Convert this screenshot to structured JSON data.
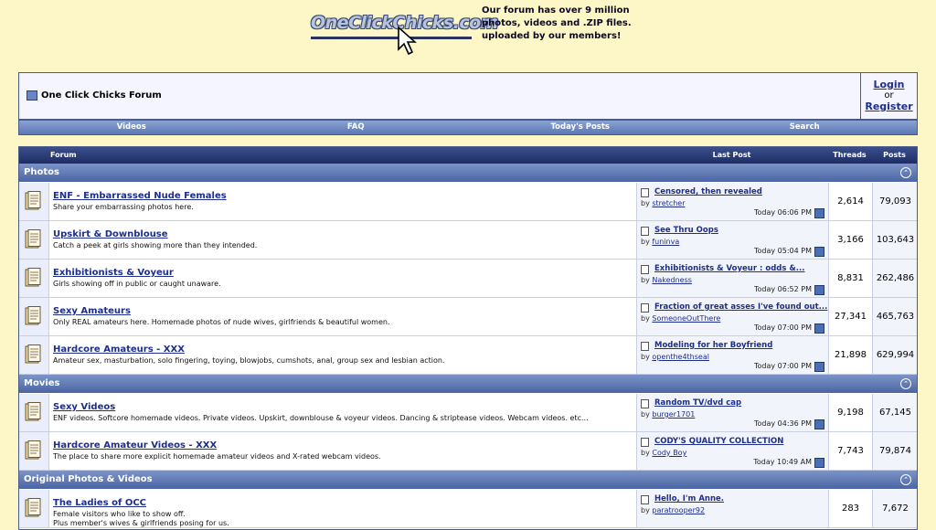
{
  "header": {
    "logo_text": "OneClickChicks.com",
    "tagline": "Our forum has over 9 million photos, videos and .ZIP files. uploaded by our members!"
  },
  "topbox": {
    "forum_name": "One Click Chicks Forum",
    "login": "Login",
    "or": "or",
    "register": "Register"
  },
  "nav": [
    "Videos",
    "FAQ",
    "Today's Posts",
    "Search"
  ],
  "table_headers": {
    "forum": "Forum",
    "last_post": "Last Post",
    "threads": "Threads",
    "posts": "Posts"
  },
  "categories": [
    {
      "name": "Photos",
      "forums": [
        {
          "title": "ENF - Embarrassed Nude Females",
          "desc": "Share your embarrassing photos here.",
          "last_title": "Censored, then revealed",
          "by": "by",
          "last_user": "stretcher",
          "when": "Today 06:06 PM",
          "threads": "2,614",
          "posts": "79,093"
        },
        {
          "title": "Upskirt & Downblouse",
          "desc": "Catch a peek at girls showing more than they intended.",
          "last_title": "See Thru Oops",
          "by": "by",
          "last_user": "funinva",
          "when": "Today 05:04 PM",
          "threads": "3,166",
          "posts": "103,643"
        },
        {
          "title": "Exhibitionists & Voyeur",
          "desc": "Girls showing off in public or caught unaware.",
          "last_title": "Exhibitionists & Voyeur : odds &...",
          "by": "by",
          "last_user": "Nakedness",
          "when": "Today 06:52 PM",
          "threads": "8,831",
          "posts": "262,486"
        },
        {
          "title": "Sexy Amateurs",
          "desc": "Only REAL amateurs here. Homemade photos of nude wives, girlfriends & beautiful women.",
          "last_title": "Fraction of great asses I've found out...",
          "by": "by",
          "last_user": "SomeoneOutThere",
          "when": "Today 07:00 PM",
          "threads": "27,341",
          "posts": "465,763"
        },
        {
          "title": "Hardcore Amateurs - XXX",
          "desc": "Amateur sex, masturbation, solo fingering, toying, blowjobs, cumshots, anal, group sex and lesbian action.",
          "last_title": "Modeling for her Boyfriend",
          "by": "by",
          "last_user": "openthe4thseal",
          "when": "Today 07:00 PM",
          "threads": "21,898",
          "posts": "629,994"
        }
      ]
    },
    {
      "name": "Movies",
      "forums": [
        {
          "title": "Sexy Videos",
          "desc": "ENF videos. Softcore homemade videos. Private videos. Upskirt, downblouse & voyeur videos. Dancing & striptease videos. Webcam videos. etc...",
          "last_title": "Random TV/dvd cap",
          "by": "by",
          "last_user": "burger1701",
          "when": "Today 04:36 PM",
          "threads": "9,198",
          "posts": "67,145"
        },
        {
          "title": "Hardcore Amateur Videos - XXX",
          "desc": "The place to share more explicit homemade amateur videos and X-rated webcam videos.",
          "last_title": "CODY'S QUALITY COLLECTION",
          "by": "by",
          "last_user": "Cody Boy",
          "when": "Today 10:49 AM",
          "threads": "7,743",
          "posts": "79,874"
        }
      ]
    },
    {
      "name": "Original Photos & Videos",
      "forums": [
        {
          "title": "The Ladies of OCC",
          "desc": "Female visitors who like to show off.\nPlus member's wives & girlfriends posing for us.",
          "last_title": "Hello, I'm Anne.",
          "by": "by",
          "last_user": "paratrooper92",
          "when": "",
          "threads": "283",
          "posts": "7,672"
        }
      ]
    }
  ],
  "icons": {
    "collapse": "collapse-icon",
    "forum": "forum-folder-icon",
    "post": "post-icon",
    "goto": "goto-last-post-icon"
  }
}
